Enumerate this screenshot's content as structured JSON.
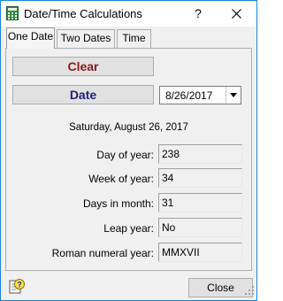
{
  "window": {
    "title": "Date/Time Calculations",
    "help_label": "?"
  },
  "tabs": [
    {
      "label": "One Date"
    },
    {
      "label": "Two Dates"
    },
    {
      "label": "Time"
    }
  ],
  "buttons": {
    "clear": "Clear",
    "date": "Date",
    "close": "Close"
  },
  "date_picker": {
    "value": "8/26/2017"
  },
  "full_date": "Saturday, August 26, 2017",
  "rows": [
    {
      "label": "Day of year:",
      "value": "238"
    },
    {
      "label": "Week of year:",
      "value": "34"
    },
    {
      "label": "Days in month:",
      "value": "31"
    },
    {
      "label": "Leap year:",
      "value": "No"
    },
    {
      "label": "Roman numeral year:",
      "value": "MMXVII"
    }
  ],
  "icons": {
    "app": "calculator-icon",
    "help": "help-icon",
    "close": "close-icon",
    "dropdown": "chevron-down-icon"
  },
  "colors": {
    "clear_text": "#8b1a1a",
    "date_text": "#1f1f7a",
    "window_border": "#1883d7",
    "app_icon": "#2e8b3e"
  }
}
